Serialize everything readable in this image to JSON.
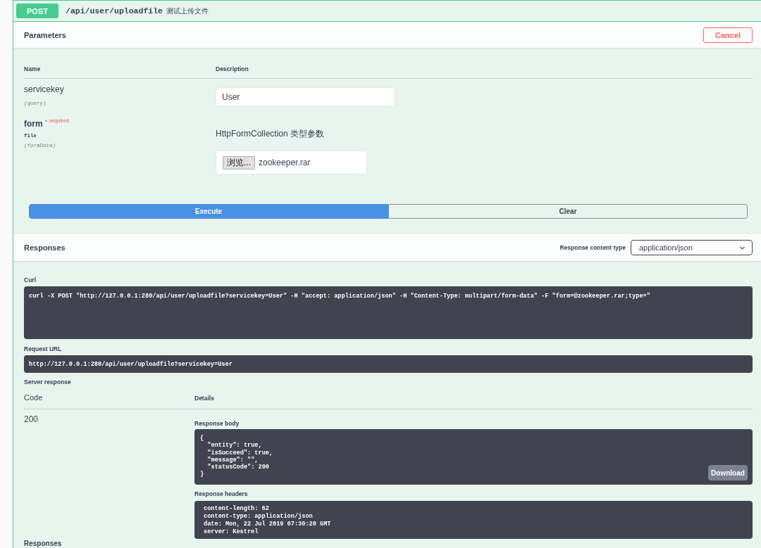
{
  "operation": {
    "method": "POST",
    "path": "/api/user/uploadfile",
    "summary": "测试上传文件"
  },
  "parameters": {
    "title": "Parameters",
    "cancel_button": "Cancel",
    "columns": [
      "Name",
      "Description"
    ],
    "rows": [
      {
        "kind": "text",
        "name": "servicekey",
        "required": false,
        "location": "(query)",
        "value": "User"
      },
      {
        "kind": "file",
        "name": "form",
        "required": true,
        "required_mark": "*",
        "required_label": "required",
        "type": "file",
        "location": "(formData)",
        "description": "HttpFormCollection 类型参数",
        "browse_button": "浏览...",
        "file_name": "zookeeper.rar"
      }
    ]
  },
  "actions": [
    {
      "kind": "primary",
      "label": "Execute"
    },
    {
      "kind": "secondary",
      "label": "Clear"
    }
  ],
  "responses": {
    "title": "Responses",
    "content_type_label": "Response content type",
    "content_type": "application/json",
    "curl_label": "Curl",
    "curl": "curl -X POST \"http://127.0.0.1:280/api/user/uploadfile?servicekey=User\" -H \"accept: application/json\" -H \"Content-Type: multipart/form-data\" -F \"form=@zookeeper.rar;type=\"",
    "request_url_label": "Request URL",
    "request_url": "http://127.0.0.1:280/api/user/uploadfile?servicekey=User",
    "server_response_label": "Server response",
    "columns": [
      "Code",
      "Details"
    ],
    "code": "200",
    "body_label": "Response body",
    "body_lines": [
      "{",
      "  \"entity\": true,",
      "  \"isSucceed\": true,",
      "  \"message\": \"\",",
      "  \"statusCode\": 200",
      "}"
    ],
    "download_button": "Download",
    "headers_label": "Response headers",
    "headers_lines": [
      "content-length: 62",
      "content-type: application/json",
      "date: Mon, 22 Jul 2019 07:30:20 GMT",
      "server: Kestrel"
    ]
  },
  "next_section": {
    "title": "Responses"
  }
}
